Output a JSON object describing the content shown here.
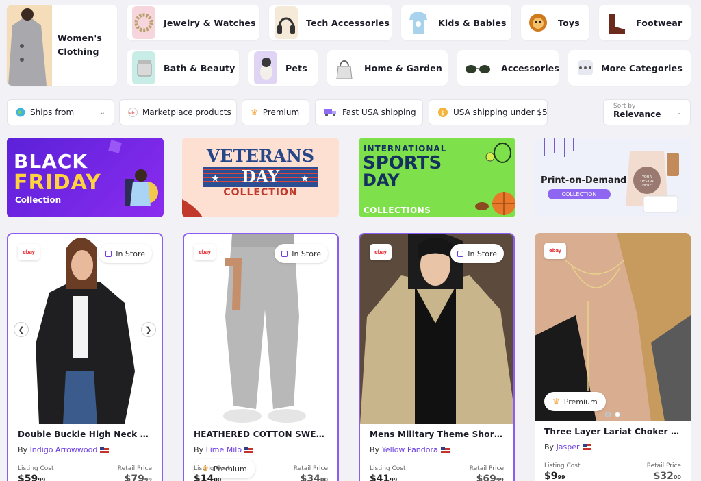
{
  "categories": {
    "featured": {
      "label": "Women's Clothing"
    },
    "row1": [
      {
        "label": "Jewelry & Watches",
        "icon": "bracelet-icon"
      },
      {
        "label": "Tech Accessories",
        "icon": "headphones-icon"
      },
      {
        "label": "Kids & Babies",
        "icon": "onesie-icon"
      },
      {
        "label": "Toys",
        "icon": "lion-toy-icon"
      },
      {
        "label": "Footwear",
        "icon": "boot-icon"
      }
    ],
    "row2": [
      {
        "label": "Bath & Beauty",
        "icon": "jar-icon"
      },
      {
        "label": "Pets",
        "icon": "dog-icon"
      },
      {
        "label": "Home & Garden",
        "icon": "kettle-icon"
      },
      {
        "label": "Accessories",
        "icon": "sunglasses-icon"
      },
      {
        "label": "More Categories",
        "icon": "more-icon",
        "badge": "•••"
      }
    ]
  },
  "filters": {
    "ships_from": "Ships from",
    "marketplace": "Marketplace products",
    "premium": "Premium",
    "fast_usa": "Fast USA shipping",
    "usa_under5": "USA shipping under $5"
  },
  "sort": {
    "caption": "Sort by",
    "value": "Relevance"
  },
  "banners": {
    "black_friday": {
      "line1": "BLACK",
      "line2": "FRIDAY",
      "line3": "Collection"
    },
    "veterans": {
      "line1": "VETERANS",
      "line2": "DAY",
      "line3": "COLLECTION"
    },
    "sports": {
      "line1": "INTERNATIONAL",
      "line2": "SPORTS",
      "line3": "DAY",
      "line4": "COLLECTIONS"
    },
    "pod": {
      "title": "Print-on-Demand",
      "button": "COLLECTION",
      "bag_text": "YOUR DESIGN HERE"
    }
  },
  "products": [
    {
      "name": "Double Buckle High Neck Veg...",
      "seller": "Indigo Arrowwood",
      "listing_label": "Listing Cost",
      "listing": "$59",
      "listing_cents": "99",
      "retail_label": "Retail Price",
      "retail": "$79",
      "retail_cents": "99",
      "in_store": "In Store"
    },
    {
      "name": "HEATHERED COTTON SWEATS",
      "seller": "Lime Milo",
      "listing_label": "Listing Cost",
      "listing": "$14",
      "listing_cents": "00",
      "retail_label": "Retail Price",
      "retail": "$34",
      "retail_cents": "00",
      "in_store": "In Store",
      "premium": "Premium"
    },
    {
      "name": "Mens Military Theme Short Ja...",
      "seller": "Yellow Pandora",
      "listing_label": "Listing Cost",
      "listing": "$41",
      "listing_cents": "99",
      "retail_label": "Retail Price",
      "retail": "$69",
      "retail_cents": "99",
      "in_store": "In Store"
    },
    {
      "name": "Three Layer Lariat Choker Nec...",
      "seller": "Jasper",
      "listing_label": "Listing Cost",
      "listing": "$9",
      "listing_cents": "99",
      "retail_label": "Retail Price",
      "retail": "$32",
      "retail_cents": "00",
      "premium": "Premium"
    }
  ],
  "common": {
    "by": "By",
    "ebay_badge": "ebay"
  },
  "colors": {
    "accent": "#6b3ee0",
    "premium": "#f3a73b",
    "ebay_red": "#e53238"
  }
}
